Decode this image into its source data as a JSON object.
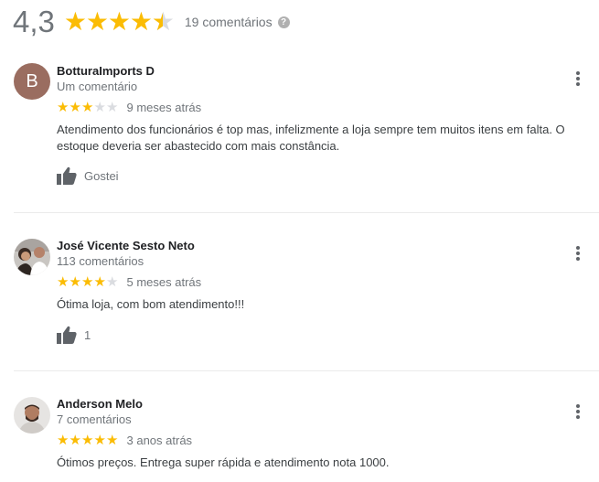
{
  "summary": {
    "rating": "4,3",
    "stars_value": 4.3,
    "total": "19 comentários",
    "info_icon": "info-icon"
  },
  "reviews": [
    {
      "name": "BotturaImports D",
      "avatar_letter": "B",
      "subtitle": "Um comentário",
      "stars": 3,
      "when": "9 meses atrás",
      "text": "Atendimento dos funcionários é top mas, infelizmente a  loja  sempre tem muitos itens em falta. O estoque deveria ser abastecido com mais constância.",
      "like_label": "Gostei"
    },
    {
      "name": "José Vicente Sesto Neto",
      "subtitle": "113 comentários",
      "stars": 4,
      "when": "5 meses atrás",
      "text": "Ótima loja, com bom atendimento!!!",
      "like_label": "1"
    },
    {
      "name": "Anderson Melo",
      "subtitle": "7 comentários",
      "stars": 5,
      "when": "3 anos atrás",
      "text": "Ótimos preços. Entrega super rápida e atendimento nota 1000."
    }
  ],
  "colors": {
    "star": "#fbbc04",
    "star_empty": "#dadce0",
    "muted": "#70757a"
  }
}
